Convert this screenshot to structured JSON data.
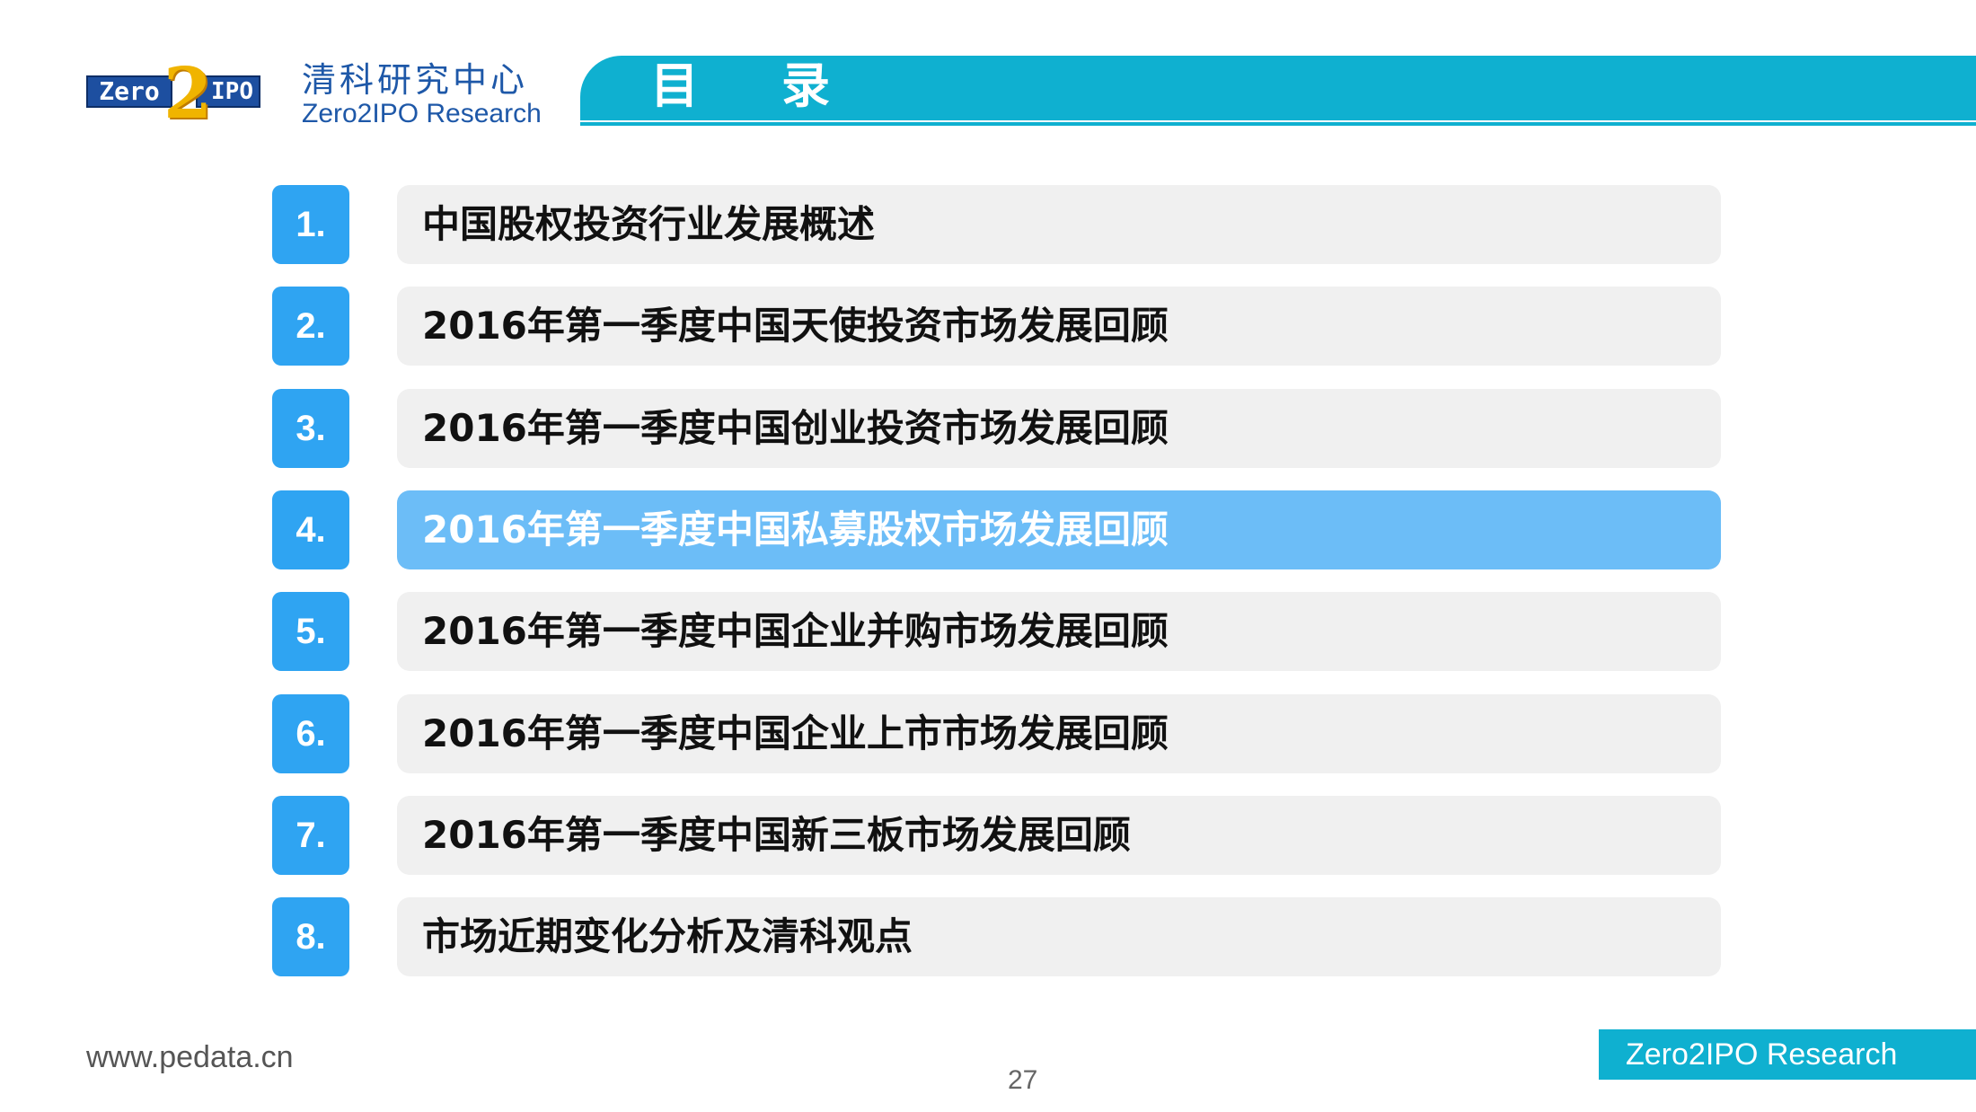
{
  "header": {
    "logo": {
      "left": "Zero",
      "middle": "2",
      "right": "IPO"
    },
    "brand_cn": "清科研究中心",
    "brand_en": "Zero2IPO Research",
    "title": "目录"
  },
  "toc": {
    "active_index": 3,
    "items": [
      {
        "number": "1.",
        "label": "中国股权投资行业发展概述"
      },
      {
        "number": "2.",
        "label": "2016年第一季度中国天使投资市场发展回顾"
      },
      {
        "number": "3.",
        "label": "2016年第一季度中国创业投资市场发展回顾"
      },
      {
        "number": "4.",
        "label": "2016年第一季度中国私募股权市场发展回顾"
      },
      {
        "number": "5.",
        "label": "2016年第一季度中国企业并购市场发展回顾"
      },
      {
        "number": "6.",
        "label": "2016年第一季度中国企业上市市场发展回顾"
      },
      {
        "number": "7.",
        "label": "2016年第一季度中国新三板市场发展回顾"
      },
      {
        "number": "8.",
        "label": "市场近期变化分析及清科观点"
      }
    ]
  },
  "footer": {
    "website": "www.pedata.cn",
    "page_number": "27",
    "brand": "Zero2IPO Research"
  },
  "colors": {
    "accent": "#0fb0d0",
    "number_box": "#2fa4f2",
    "active_bar": "#6cbdf7",
    "bar": "#f0f0f0",
    "brand_text": "#1e58a8"
  }
}
